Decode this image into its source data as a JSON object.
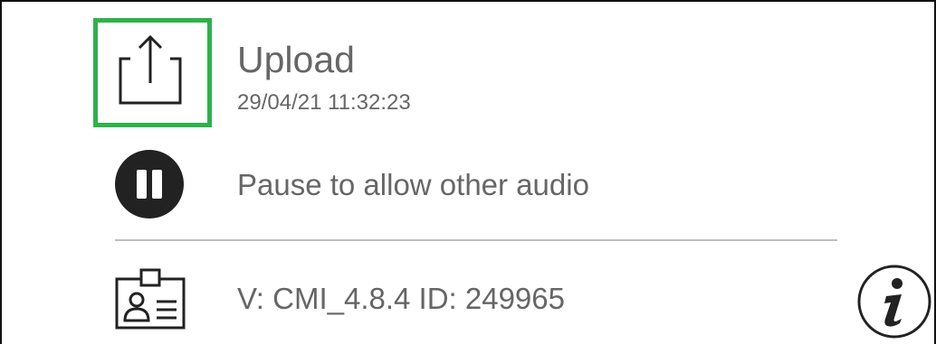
{
  "upload": {
    "title": "Upload",
    "timestamp": "29/04/21 11:32:23"
  },
  "audio": {
    "pause_label": "Pause to allow other audio"
  },
  "device": {
    "version_text": "V: CMI_4.8.4 ID: 249965"
  },
  "icons": {
    "upload": "share-upload-icon",
    "pause": "pause-icon",
    "id_card": "id-card-icon",
    "info": "info-icon"
  },
  "colors": {
    "highlight": "#2db24a",
    "text": "#666666",
    "icon": "#222222"
  }
}
